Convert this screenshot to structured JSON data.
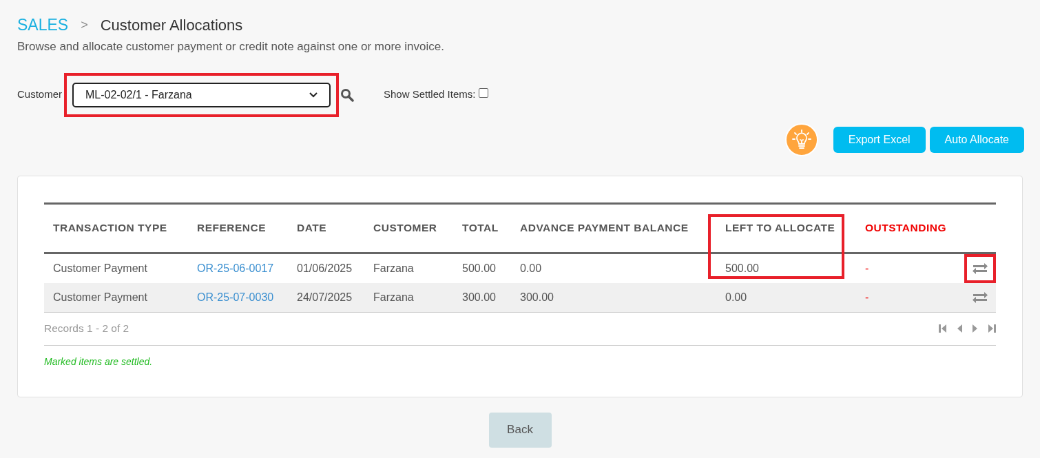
{
  "breadcrumb": {
    "section": "SALES",
    "separator": ">",
    "page": "Customer Allocations"
  },
  "description": "Browse and allocate customer payment or credit note against one or more invoice.",
  "filter": {
    "customer_label": "Customer",
    "customer_value": "ML-02-02/1 - Farzana",
    "customer_highlighted": true,
    "settled_label": "Show Settled Items:",
    "show_settled": false
  },
  "actions": [
    "Export Excel",
    "Auto Allocate"
  ],
  "table": {
    "columns": [
      {
        "label": "TRANSACTION TYPE",
        "kind": "normal",
        "highlighted": false
      },
      {
        "label": "REFERENCE",
        "kind": "normal",
        "highlighted": false
      },
      {
        "label": "DATE",
        "kind": "normal",
        "highlighted": false
      },
      {
        "label": "CUSTOMER",
        "kind": "normal",
        "highlighted": false
      },
      {
        "label": "TOTAL",
        "kind": "normal",
        "highlighted": false
      },
      {
        "label": "ADVANCE PAYMENT BALANCE",
        "kind": "normal",
        "highlighted": false
      },
      {
        "label": "LEFT TO ALLOCATE",
        "kind": "normal",
        "highlighted": true
      },
      {
        "label": "OUTSTANDING",
        "kind": "alert",
        "highlighted": false
      }
    ],
    "rows": [
      {
        "cells": [
          "Customer Payment",
          "OR-25-06-0017",
          "01/06/2025",
          "Farzana",
          "500.00",
          "0.00",
          "500.00",
          "-"
        ],
        "action_highlighted": true
      },
      {
        "cells": [
          "Customer Payment",
          "OR-25-07-0030",
          "24/07/2025",
          "Farzana",
          "300.00",
          "300.00",
          "0.00",
          "-"
        ],
        "action_highlighted": false
      }
    ],
    "records": "Records 1 - 2 of 2"
  },
  "note": "Marked items are settled.",
  "back_button": "Back"
}
